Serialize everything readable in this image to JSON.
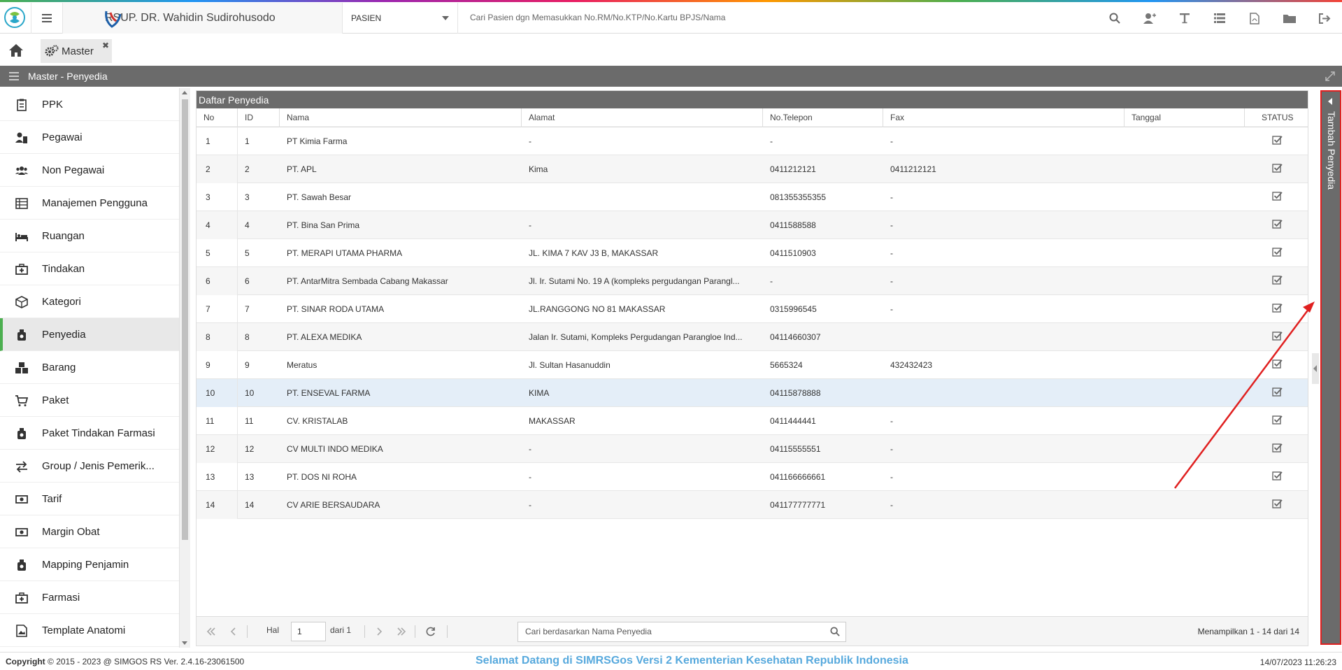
{
  "topbar": {
    "hospital_name": "RSUP. DR. Wahidin Sudirohusodo",
    "module": "PASIEN",
    "search_placeholder": "Cari Pasien dgn Memasukkan No.RM/No.KTP/No.Kartu BPJS/Nama",
    "icons": [
      "search-icon",
      "add-user-icon",
      "text-icon",
      "list-icon",
      "pdf-icon",
      "folder-icon",
      "logout-icon"
    ]
  },
  "tabs": [
    {
      "label": "Master"
    }
  ],
  "panel": {
    "title": "Master - Penyedia"
  },
  "sidebar": {
    "items": [
      {
        "label": "PPK"
      },
      {
        "label": "Pegawai"
      },
      {
        "label": "Non Pegawai"
      },
      {
        "label": "Manajemen Pengguna"
      },
      {
        "label": "Ruangan"
      },
      {
        "label": "Tindakan"
      },
      {
        "label": "Kategori"
      },
      {
        "label": "Penyedia"
      },
      {
        "label": "Barang"
      },
      {
        "label": "Paket"
      },
      {
        "label": "Paket Tindakan Farmasi"
      },
      {
        "label": "Group / Jenis Pemerik..."
      },
      {
        "label": "Tarif"
      },
      {
        "label": "Margin Obat"
      },
      {
        "label": "Mapping Penjamin"
      },
      {
        "label": "Farmasi"
      },
      {
        "label": "Template Anatomi"
      }
    ],
    "active_index": 7
  },
  "grid": {
    "title": "Daftar Penyedia",
    "columns": [
      "No",
      "ID",
      "Nama",
      "Alamat",
      "No.Telepon",
      "Fax",
      "Tanggal",
      "STATUS"
    ],
    "rows": [
      {
        "no": "1",
        "id": "1",
        "nama": "PT Kimia Farma",
        "alamat": "-",
        "telp": "-",
        "fax": "-",
        "tanggal": ""
      },
      {
        "no": "2",
        "id": "2",
        "nama": "PT. APL",
        "alamat": "Kima",
        "telp": "0411212121",
        "fax": "0411212121",
        "tanggal": ""
      },
      {
        "no": "3",
        "id": "3",
        "nama": "PT. Sawah Besar",
        "alamat": "",
        "telp": "081355355355",
        "fax": "-",
        "tanggal": ""
      },
      {
        "no": "4",
        "id": "4",
        "nama": "PT. Bina San Prima",
        "alamat": "-",
        "telp": "0411588588",
        "fax": "-",
        "tanggal": ""
      },
      {
        "no": "5",
        "id": "5",
        "nama": "PT. MERAPI UTAMA PHARMA",
        "alamat": "JL. KIMA 7 KAV J3 B, MAKASSAR",
        "telp": "0411510903",
        "fax": "-",
        "tanggal": ""
      },
      {
        "no": "6",
        "id": "6",
        "nama": "PT. AntarMitra Sembada Cabang Makassar",
        "alamat": "Jl. Ir. Sutami No. 19 A (kompleks pergudangan Parangl...",
        "telp": "-",
        "fax": "-",
        "tanggal": ""
      },
      {
        "no": "7",
        "id": "7",
        "nama": "PT. SINAR RODA UTAMA",
        "alamat": "JL.RANGGONG NO 81 MAKASSAR",
        "telp": "0315996545",
        "fax": "-",
        "tanggal": ""
      },
      {
        "no": "8",
        "id": "8",
        "nama": "PT. ALEXA MEDIKA",
        "alamat": "Jalan Ir. Sutami, Kompleks Pergudangan Parangloe Ind...",
        "telp": "04114660307",
        "fax": "",
        "tanggal": ""
      },
      {
        "no": "9",
        "id": "9",
        "nama": "Meratus",
        "alamat": "Jl. Sultan Hasanuddin",
        "telp": "5665324",
        "fax": "432432423",
        "tanggal": ""
      },
      {
        "no": "10",
        "id": "10",
        "nama": "PT. ENSEVAL FARMA",
        "alamat": "KIMA",
        "telp": "04115878888",
        "fax": "",
        "tanggal": ""
      },
      {
        "no": "11",
        "id": "11",
        "nama": "CV. KRISTALAB",
        "alamat": "MAKASSAR",
        "telp": "0411444441",
        "fax": "-",
        "tanggal": ""
      },
      {
        "no": "12",
        "id": "12",
        "nama": "CV MULTI INDO MEDIKA",
        "alamat": "-",
        "telp": "04115555551",
        "fax": "-",
        "tanggal": ""
      },
      {
        "no": "13",
        "id": "13",
        "nama": "PT. DOS NI ROHA",
        "alamat": "-",
        "telp": "041166666661",
        "fax": "-",
        "tanggal": ""
      },
      {
        "no": "14",
        "id": "14",
        "nama": "CV ARIE BERSAUDARA",
        "alamat": "-",
        "telp": "041177777771",
        "fax": "-",
        "tanggal": ""
      }
    ],
    "selected_row_index": 9
  },
  "pager": {
    "hal_label": "Hal",
    "page": "1",
    "of_label": "dari 1",
    "search_placeholder": "Cari berdasarkan Nama Penyedia",
    "info": "Menampilkan 1 - 14 dari 14"
  },
  "right_panel": {
    "label": "Tambah Penyedia"
  },
  "footer": {
    "copyright_label": "Copyright",
    "copyright_text": "2015 - 2023 @ SIMGOS RS Ver. 2.4.16-23061500",
    "welcome": "Selamat Datang di SIMRSGos Versi 2 Kementerian Kesehatan Republik Indonesia",
    "datetime": "14/07/2023 11:26:23"
  },
  "colors": {
    "panel_header": "#6b6b6b",
    "active_accent": "#4caf50",
    "welcome_text": "#57a9dd",
    "annotation": "#e02020"
  }
}
